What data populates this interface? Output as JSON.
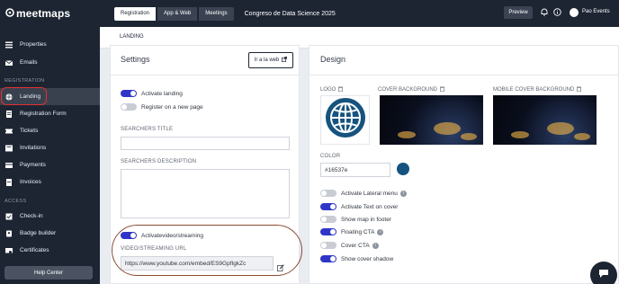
{
  "brand": {
    "logo_text": "meetmaps"
  },
  "sidebar": {
    "items_top": [
      {
        "label": "Properties",
        "icon": "properties-icon"
      },
      {
        "label": "Emails",
        "icon": "emails-icon"
      }
    ],
    "section_registration": "REGISTRATION",
    "items_registration": [
      {
        "label": "Landing",
        "icon": "globe-icon"
      },
      {
        "label": "Registration Form",
        "icon": "form-icon"
      },
      {
        "label": "Tickets",
        "icon": "ticket-icon"
      },
      {
        "label": "Invitations",
        "icon": "invitation-icon"
      },
      {
        "label": "Payments",
        "icon": "payments-icon"
      },
      {
        "label": "Invoices",
        "icon": "invoices-icon"
      }
    ],
    "section_access": "ACCESS",
    "items_access": [
      {
        "label": "Check-in",
        "icon": "checkin-icon"
      },
      {
        "label": "Badge builder",
        "icon": "badge-icon"
      },
      {
        "label": "Certificates",
        "icon": "certificates-icon"
      }
    ],
    "help_label": "Help Center"
  },
  "topbar": {
    "tabs": [
      "Registration",
      "App & Web",
      "Meetings"
    ],
    "event_title": "Congreso de Data Science 2025",
    "preview_label": "Preview",
    "user_name": "Pao Events"
  },
  "subtabs": {
    "active": "LANDING"
  },
  "settings": {
    "title": "Settings",
    "web_button": "Ir a la web",
    "activate_landing": "Activate landing",
    "register_new_page": "Register on a new page",
    "searchers_title_label": "SEARCHERS TITLE",
    "searchers_title_value": "",
    "searchers_description_label": "SEARCHERS DESCRIPTION",
    "searchers_description_value": "",
    "activate_video": "Activatevideo/streaming",
    "video_url_label": "VIDEO/STREAMING URL",
    "video_url_value": "https://www.youtube.com/embed/ES9GpfIgkZc"
  },
  "design": {
    "title": "Design",
    "logo_label": "LOGO",
    "cover_label": "COVER BACKGROUND",
    "mobile_cover_label": "MOBILE COVER BACKGROUND",
    "color_label": "COLOR",
    "color_value": "#16537e",
    "color_hex": "#16537e",
    "toggles": [
      {
        "label": "Activate Lateral menu",
        "on": false,
        "info": true
      },
      {
        "label": "Activate Text on cover",
        "on": true,
        "info": false
      },
      {
        "label": "Show map in footer",
        "on": false,
        "info": false
      },
      {
        "label": "Floating CTA",
        "on": true,
        "info": true
      },
      {
        "label": "Cover CTA",
        "on": false,
        "info": true
      },
      {
        "label": "Show cover shadow",
        "on": true,
        "info": false
      }
    ]
  },
  "colors": {
    "sidebar_bg": "#1d2533",
    "toggle_on": "#2f36c7",
    "highlight_red": "#e53030"
  }
}
